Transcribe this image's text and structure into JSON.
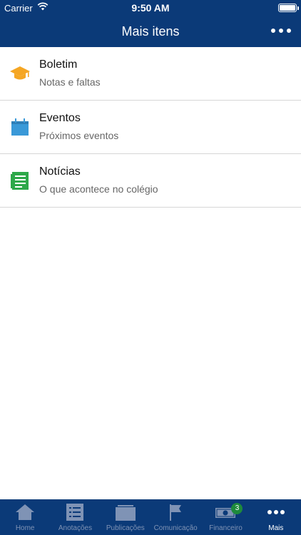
{
  "status_bar": {
    "carrier": "Carrier",
    "time": "9:50 AM"
  },
  "header": {
    "title": "Mais itens",
    "more_icon": "more-dots-icon"
  },
  "menu_items": [
    {
      "title": "Boletim",
      "subtitle": "Notas e faltas",
      "icon": "graduation-cap-icon",
      "icon_color": "#f5a623"
    },
    {
      "title": "Eventos",
      "subtitle": "Próximos eventos",
      "icon": "calendar-icon",
      "icon_color": "#3a99d8"
    },
    {
      "title": "Notícias",
      "subtitle": "O que acontece no colégio",
      "icon": "news-icon",
      "icon_color": "#2ea84a"
    }
  ],
  "tab_bar": {
    "tabs": [
      {
        "label": "Home",
        "icon": "home-icon",
        "active": false
      },
      {
        "label": "Anotações",
        "icon": "notes-list-icon",
        "active": false
      },
      {
        "label": "Publicações",
        "icon": "publications-icon",
        "active": false
      },
      {
        "label": "Comunicação",
        "icon": "flag-icon",
        "active": false
      },
      {
        "label": "Financeiro",
        "icon": "money-icon",
        "active": false,
        "badge": "3"
      },
      {
        "label": "Mais",
        "icon": "more-dots-icon",
        "active": true
      }
    ]
  },
  "colors": {
    "header_bg": "#0b3a78",
    "tab_inactive": "#7f93b5",
    "tab_active": "#ffffff"
  }
}
